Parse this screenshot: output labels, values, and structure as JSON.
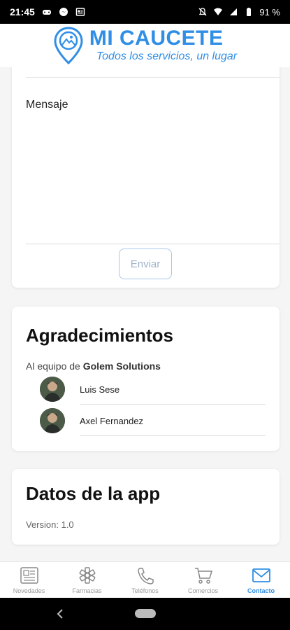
{
  "status_bar": {
    "time": "21:45",
    "battery": "91 %"
  },
  "header": {
    "title": "MI CAUCETE",
    "subtitle": "Todos los servicios, un lugar"
  },
  "message_form": {
    "label": "Mensaje",
    "send_label": "Enviar"
  },
  "thanks": {
    "title": "Agradecimientos",
    "intro": "Al equipo de ",
    "team": "Golem Solutions",
    "people": [
      {
        "name": "Luis Sese"
      },
      {
        "name": "Axel Fernandez"
      }
    ]
  },
  "app_info": {
    "title": "Datos de la app",
    "version": "Version: 1.0"
  },
  "bottom_nav": {
    "items": [
      {
        "label": "Novedades",
        "icon": "newspaper-icon"
      },
      {
        "label": "Farmacias",
        "icon": "medical-star-icon"
      },
      {
        "label": "Teléfonos",
        "icon": "phone-icon"
      },
      {
        "label": "Comercios",
        "icon": "cart-icon"
      },
      {
        "label": "Contacto",
        "icon": "mail-icon",
        "active": true
      }
    ]
  },
  "colors": {
    "brand": "#2f8ee6",
    "inactive": "#999999"
  }
}
